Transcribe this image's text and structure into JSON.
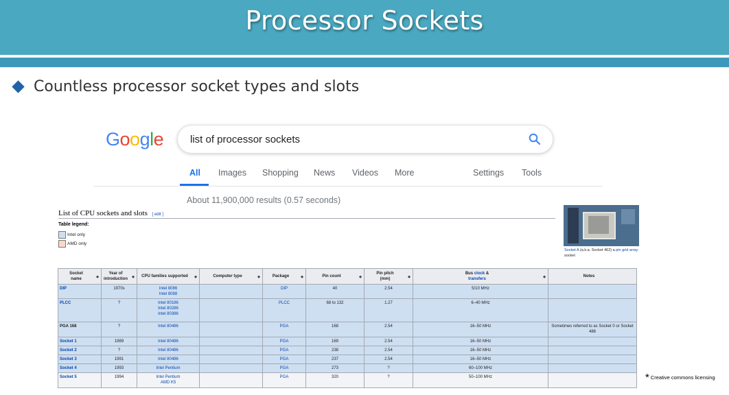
{
  "slide": {
    "title": "Processor Sockets",
    "bullet": "Countless processor socket types and slots",
    "footnote_star": "*",
    "footnote": "Creative commons licensing"
  },
  "google": {
    "logo_letters": [
      "G",
      "o",
      "o",
      "g",
      "l",
      "e"
    ],
    "logo_colors": [
      "#4285f4",
      "#ea4335",
      "#fbbc05",
      "#4285f4",
      "#34a853",
      "#ea4335"
    ],
    "search_query": "list of processor sockets",
    "tabs": [
      "All",
      "Images",
      "Shopping",
      "News",
      "Videos",
      "More"
    ],
    "right_tabs": [
      "Settings",
      "Tools"
    ],
    "active_tab": "All",
    "accent_color": "#1a73e8",
    "results_text": "About 11,900,000 results (0.57 seconds)"
  },
  "wiki": {
    "heading": "List of CPU sockets and slots",
    "edit_label": "[ edit ]",
    "legend_title": "Table legend:",
    "legend": [
      {
        "label": "Intel only",
        "color": "#cedff2"
      },
      {
        "label": "AMD only",
        "color": "#fbd8c6"
      }
    ],
    "image_icon": "socket-photo",
    "caption": {
      "link1": "Socket A",
      "text1": " (a.k.a. Socket 462) a ",
      "link2": "pin grid array",
      "text2": " socket"
    }
  },
  "table": {
    "headers": [
      "Socket name",
      "Year of introduction",
      "CPU families supported",
      "Computer type",
      "Package",
      "Pin count",
      "Pin pitch (mm)",
      "Bus clock & transfers",
      "Notes"
    ],
    "header_parts": {
      "socket": [
        "Socket",
        "name"
      ],
      "year": [
        "Year of",
        "introduction"
      ],
      "pitch": [
        "Pin pitch",
        "(mm)"
      ],
      "bus_link1": "clock",
      "bus_pre": "Bus ",
      "bus_mid": " &",
      "bus_link2": "transfers"
    },
    "rows": [
      {
        "name": "DIP",
        "name_link": true,
        "year": "1970s",
        "cpu": [
          "Intel 8086",
          "Intel 8088"
        ],
        "type": "",
        "package": "DIP",
        "pins": "40",
        "pitch": "2.54",
        "bus": "5/10 MHz",
        "notes": ""
      },
      {
        "name": "PLCC",
        "name_link": true,
        "year": "?",
        "cpu": [
          "Intel 80186",
          "Intel 80286",
          "Intel 80386"
        ],
        "type": "",
        "package": "PLCC",
        "pins": "68 to 132",
        "pitch": "1.27",
        "bus": "6–40 MHz",
        "notes": ""
      },
      {
        "name": "PGA 168",
        "name_link": false,
        "year": "?",
        "cpu": [
          "Intel 80486"
        ],
        "type": "",
        "package": "PGA",
        "pins": "168",
        "pitch": "2.54",
        "bus": "16–50 MHz",
        "notes": "Sometimes referred to as Socket 0 or Socket 486"
      },
      {
        "name": "Socket 1",
        "name_link": true,
        "year": "1989",
        "cpu": [
          "Intel 80486"
        ],
        "type": "",
        "package": "PGA",
        "pins": "169",
        "pitch": "2.54",
        "bus": "16–50 MHz",
        "notes": ""
      },
      {
        "name": "Socket 2",
        "name_link": true,
        "year": "?",
        "cpu": [
          "Intel 80486"
        ],
        "type": "",
        "package": "PGA",
        "pins": "238",
        "pitch": "2.54",
        "bus": "16–50 MHz",
        "notes": ""
      },
      {
        "name": "Socket 3",
        "name_link": true,
        "year": "1991",
        "cpu": [
          "Intel 80486"
        ],
        "type": "",
        "package": "PGA",
        "pins": "237",
        "pitch": "2.54",
        "bus": "16–50 MHz",
        "notes": ""
      },
      {
        "name": "Socket 4",
        "name_link": true,
        "year": "1993",
        "cpu": [
          "Intel Pentium"
        ],
        "type": "",
        "package": "PGA",
        "pins": "273",
        "pitch": "?",
        "bus": "60–100 MHz",
        "notes": ""
      },
      {
        "name": "Socket 5",
        "name_link": true,
        "year": "1994",
        "cpu": [
          "Intel Pentium",
          "AMD K5"
        ],
        "type": "",
        "package": "PGA",
        "pins": "320",
        "pitch": "?",
        "bus": "50–100 MHz",
        "notes": "",
        "mixed": true
      }
    ]
  }
}
